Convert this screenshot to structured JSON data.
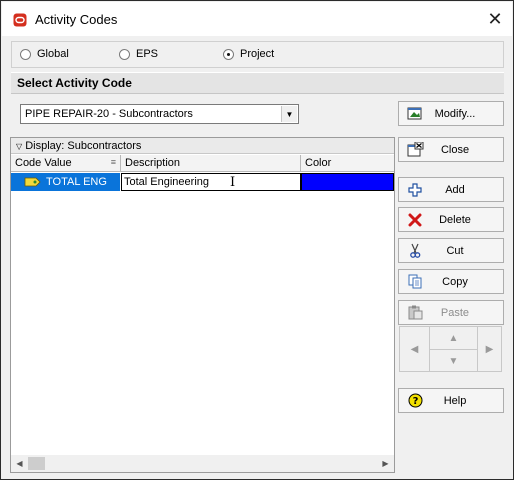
{
  "window": {
    "title": "Activity Codes",
    "close_glyph": "✕",
    "app_icon": "oracle-o-icon",
    "accent_color": "#d42f1f"
  },
  "scope": {
    "options": [
      "Global",
      "EPS",
      "Project"
    ],
    "selected": "Project"
  },
  "section": {
    "title": "Select Activity Code"
  },
  "code_select": {
    "value": "PIPE REPAIR-20 - Subcontractors"
  },
  "buttons": {
    "modify": "Modify...",
    "close": "Close",
    "add": "Add",
    "delete": "Delete",
    "cut": "Cut",
    "copy": "Copy",
    "paste": "Paste",
    "help": "Help"
  },
  "grid": {
    "display_label": "Display: Subcontractors",
    "columns": [
      "Code Value",
      "Description",
      "Color"
    ],
    "rows": [
      {
        "code_value": "TOTAL ENG",
        "description": "Total Engineering",
        "color": "#0000ff"
      }
    ]
  }
}
